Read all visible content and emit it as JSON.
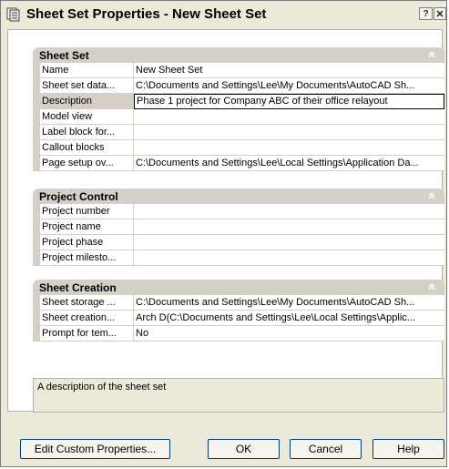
{
  "window": {
    "title": "Sheet Set Properties - New Sheet Set"
  },
  "categories": [
    {
      "title": "Sheet Set",
      "rows": [
        {
          "label": "Name",
          "value": "New Sheet Set"
        },
        {
          "label": "Sheet set data...",
          "value": "C:\\Documents and Settings\\Lee\\My Documents\\AutoCAD Sh..."
        },
        {
          "label": "Description",
          "value": "Phase 1 project for Company ABC of their office relayout"
        },
        {
          "label": "Model view",
          "value": ""
        },
        {
          "label": "Label block for...",
          "value": ""
        },
        {
          "label": "Callout blocks",
          "value": ""
        },
        {
          "label": "Page setup ov...",
          "value": "C:\\Documents and Settings\\Lee\\Local Settings\\Application Da..."
        }
      ]
    },
    {
      "title": "Project Control",
      "rows": [
        {
          "label": "Project number",
          "value": ""
        },
        {
          "label": "Project name",
          "value": ""
        },
        {
          "label": "Project phase",
          "value": ""
        },
        {
          "label": "Project milesto...",
          "value": ""
        }
      ]
    },
    {
      "title": "Sheet Creation",
      "rows": [
        {
          "label": "Sheet storage ...",
          "value": "C:\\Documents and Settings\\Lee\\My Documents\\AutoCAD Sh..."
        },
        {
          "label": "Sheet creation...",
          "value": "Arch D(C:\\Documents and Settings\\Lee\\Local Settings\\Applic..."
        },
        {
          "label": "Prompt for tem...",
          "value": "No"
        }
      ]
    }
  ],
  "description_text": "A description of the sheet set",
  "buttons": {
    "edit_custom": "Edit Custom Properties...",
    "ok": "OK",
    "cancel": "Cancel",
    "help": "Help"
  },
  "icons": {
    "app": "sheet-set-app-icon",
    "help": "help-icon",
    "close": "close-icon",
    "collapse": "collapse-chevron-icon"
  },
  "colors": {
    "dialog_bg": "#ece9d8",
    "category_bg": "#d4d0c8"
  }
}
